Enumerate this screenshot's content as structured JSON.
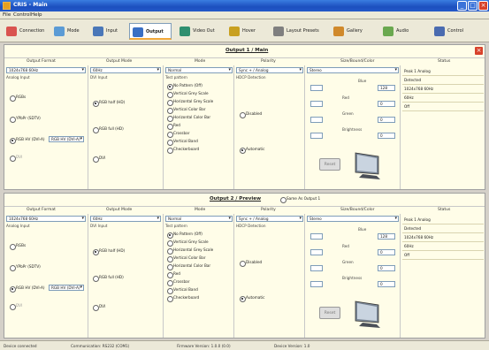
{
  "window": {
    "title": "CRIS - Main"
  },
  "menu": [
    "File",
    "Control",
    "Help"
  ],
  "tabs": [
    {
      "label": "Connection",
      "color": "#d9534f"
    },
    {
      "label": "Mode",
      "color": "#5b9bd5"
    },
    {
      "label": "Input",
      "color": "#4a77b8"
    },
    {
      "label": "Output",
      "color": "#3a6fc4"
    },
    {
      "label": "Video Out",
      "color": "#2f8f6f"
    },
    {
      "label": "Hover",
      "color": "#c8a020"
    },
    {
      "label": "Layout Presets",
      "color": "#7f7f7f"
    },
    {
      "label": "Gallery",
      "color": "#d0892b"
    },
    {
      "label": "Audio",
      "color": "#6aa84f"
    },
    {
      "label": "Control",
      "color": "#4a6bb0"
    }
  ],
  "columns": [
    "Output Format",
    "Output Mode",
    "Mode",
    "Polarity",
    "Size/Bound/Color",
    "Status"
  ],
  "output1": {
    "title": "Output 1 / Main",
    "format": "1024x768 60Hz",
    "mode": "60Hz",
    "mode_type": "Normal",
    "polarity": "Sync + / Analog",
    "size": "Stereo",
    "sub_format": "Analog Input",
    "sub_mode": "DVI Input",
    "sub_type": "Test pattern",
    "sub_polarity": "HDCP Detection",
    "format_opts": [
      "RGBs",
      "YPbPr (SDTV)",
      "RGB HV (DVI-A)",
      "DVI"
    ],
    "format_sel": "RGB HV (DVI-A)",
    "mode_opts": [
      "RGB half (HD)",
      "RGB full (HD)",
      "DVI"
    ],
    "pattern_opts": [
      "No Pattern (Off)",
      "Vertical Grey Scale",
      "Horizontal Grey Scale",
      "Vertical Color Bar",
      "Horizontal Color Bar",
      "Red",
      "Crossbar",
      "Vertical Band",
      "Checkerboard"
    ],
    "hdcp_opts": [
      "Disabled",
      "Automatic"
    ],
    "color_rows": [
      {
        "label": "Blue",
        "value": "128"
      },
      {
        "label": "Red",
        "value": "0"
      },
      {
        "label": "Green",
        "value": "0"
      },
      {
        "label": "Brightness",
        "value": "0"
      }
    ],
    "reset_label": "Reset",
    "status": [
      "Peak 1 Analog",
      "Detected",
      "1024x768 60Hz",
      "60Hz",
      "Off"
    ]
  },
  "output2": {
    "title": "Output 2 / Preview",
    "same_label": "Same As Output 1",
    "format": "1024x768 60Hz",
    "mode": "60Hz",
    "mode_type": "Normal",
    "polarity": "Sync + / Analog",
    "size": "Stereo",
    "sub_format": "Analog Input",
    "sub_mode": "DVI Input",
    "sub_type": "Test pattern",
    "sub_polarity": "HDCP Detection",
    "format_opts": [
      "RGBs",
      "YPbPr (SDTV)",
      "RGB HV (DVI-A)",
      "DVI"
    ],
    "format_sel": "RGB HV (DVI-A)",
    "mode_opts": [
      "RGB half (HD)",
      "RGB full (HD)",
      "DVI"
    ],
    "pattern_opts": [
      "No Pattern (Off)",
      "Vertical Grey Scale",
      "Horizontal Grey Scale",
      "Vertical Color Bar",
      "Horizontal Color Bar",
      "Red",
      "Crossbar",
      "Vertical Band",
      "Checkerboard"
    ],
    "hdcp_opts": [
      "Disabled",
      "Automatic"
    ],
    "color_rows": [
      {
        "label": "Blue",
        "value": "128"
      },
      {
        "label": "Red",
        "value": "0"
      },
      {
        "label": "Green",
        "value": "0"
      },
      {
        "label": "Brightness",
        "value": "0"
      }
    ],
    "reset_label": "Reset",
    "status": [
      "Peak 1 Analog",
      "Detected",
      "1024x768 60Hz",
      "60Hz",
      "Off"
    ]
  },
  "statusbar": {
    "connection": "Device connected",
    "comm": "Communication: RS232 (COM1)",
    "firmware": "Firmware Version: 1.0.0 (0.0)",
    "device": "Device Version: 1.0"
  }
}
